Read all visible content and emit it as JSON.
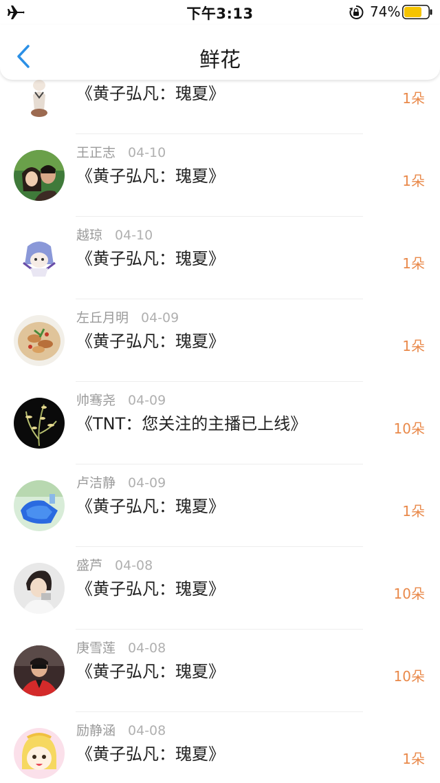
{
  "status_bar": {
    "time": "下午3:13",
    "battery": "74%",
    "battery_level": 0.74,
    "battery_color": "#f5c400"
  },
  "nav": {
    "title": "鲜花",
    "back_icon": "chevron-left-icon",
    "accent": "#2b90e6"
  },
  "colors": {
    "count": "#e9894a",
    "meta": "#9a9a9a"
  },
  "rows": [
    {
      "user": "",
      "date": "",
      "gift": "《黄子弘凡：瑰夏》",
      "count": "1朵"
    },
    {
      "user": "王正志",
      "date": "04-10",
      "gift": "《黄子弘凡：瑰夏》",
      "count": "1朵"
    },
    {
      "user": "越琼",
      "date": "04-10",
      "gift": "《黄子弘凡：瑰夏》",
      "count": "1朵"
    },
    {
      "user": "左丘月明",
      "date": "04-09",
      "gift": "《黄子弘凡：瑰夏》",
      "count": "1朵"
    },
    {
      "user": "帅骞尧",
      "date": "04-09",
      "gift": "《TNT：您关注的主播已上线》",
      "count": "10朵"
    },
    {
      "user": "卢洁静",
      "date": "04-09",
      "gift": "《黄子弘凡：瑰夏》",
      "count": "1朵"
    },
    {
      "user": "盛芦",
      "date": "04-08",
      "gift": "《黄子弘凡：瑰夏》",
      "count": "10朵"
    },
    {
      "user": "庚雪莲",
      "date": "04-08",
      "gift": "《黄子弘凡：瑰夏》",
      "count": "10朵"
    },
    {
      "user": "励静涵",
      "date": "04-08",
      "gift": "《黄子弘凡：瑰夏》",
      "count": "1朵"
    }
  ]
}
